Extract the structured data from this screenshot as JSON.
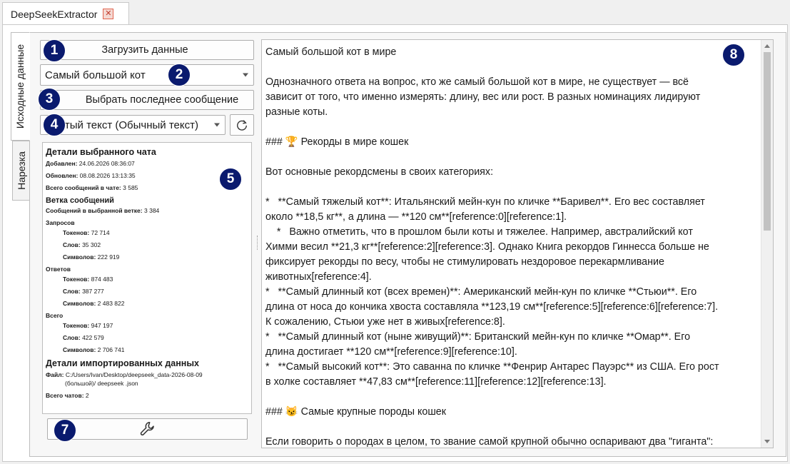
{
  "app": {
    "tab_title": "DeepSeekExtractor",
    "close_glyph": "✕"
  },
  "vertical_tabs": [
    {
      "label": "Исходные данные",
      "active": true
    },
    {
      "label": "Нарезка",
      "active": false
    }
  ],
  "controls": {
    "load_button": "Загрузить данные",
    "chat_select": "Самый большой кот",
    "last_message_button": "Выбрать последнее сообщение",
    "format_select": "Чистый текст (Обычный текст)",
    "refresh_icon": "refresh-icon",
    "tools_icon": "wrench-icon"
  },
  "badges": [
    "1",
    "2",
    "3",
    "4",
    "5",
    "7",
    "8"
  ],
  "details": {
    "chat_title": "Детали выбранного чата",
    "added_label": "Добавлен:",
    "added_value": "24.06.2026 08:36:07",
    "updated_label": "Обновлен:",
    "updated_value": "08.08.2026 13:13:35",
    "total_msgs_label": "Всего сообщений в чате:",
    "total_msgs_value": "3 585",
    "branch_title": "Ветка сообщений",
    "branch_msgs_label": "Сообщений в выбранной ветке:",
    "branch_msgs_value": "3 384",
    "requests_title": "Запросов",
    "req_tokens_label": "Токенов:",
    "req_tokens_value": "72 714",
    "req_words_label": "Слов:",
    "req_words_value": "35 302",
    "req_chars_label": "Символов:",
    "req_chars_value": "222 919",
    "answers_title": "Ответов",
    "ans_tokens_label": "Токенов:",
    "ans_tokens_value": "874 483",
    "ans_words_label": "Слов:",
    "ans_words_value": "387 277",
    "ans_chars_label": "Символов:",
    "ans_chars_value": "2 483 822",
    "total_title": "Всего",
    "tot_tokens_label": "Токенов:",
    "tot_tokens_value": "947 197",
    "tot_words_label": "Слов:",
    "tot_words_value": "422 579",
    "tot_chars_label": "Символов:",
    "tot_chars_value": "2 706 741",
    "import_title": "Детали импортированных данных",
    "file_label": "Файл:",
    "file_value_1": "C:/Users/Ivan/Desktop/deepseek_data-2026-08-09",
    "file_value_2": "(большой)/ deepseek .json",
    "total_chats_label": "Всего чатов:",
    "total_chats_value": "2"
  },
  "content": {
    "lines": [
      "Самый большой кот в мире",
      "",
      "Однозначного ответа на вопрос, кто же самый большой кот в мире, не существует — всё",
      "зависит от того, что именно измерять: длину, вес или рост. В разных номинациях лидируют",
      "разные коты.",
      "",
      "### 🏆 Рекорды в мире кошек",
      "",
      "Вот основные рекордсмены в своих категориях:",
      "",
      "*   **Самый тяжелый кот**: Итальянский мейн-кун по кличке **Баривел**. Его вес составляет",
      "около **18,5 кг**, а длина — **120 см**[reference:0][reference:1].",
      "    *   Важно отметить, что в прошлом были коты и тяжелее. Например, австралийский кот",
      "Химми весил **21,3 кг**[reference:2][reference:3]. Однако Книга рекордов Гиннесса больше не",
      "фиксирует рекорды по весу, чтобы не стимулировать нездоровое перекармливание",
      "животных[reference:4].",
      "*   **Самый длинный кот (всех времен)**: Американский мейн-кун по кличке **Стьюи**. Его",
      "длина от носа до кончика хвоста составляла **123,19 см**[reference:5][reference:6][reference:7].",
      "К сожалению, Стьюи уже нет в живых[reference:8].",
      "*   **Самый длинный кот (ныне живущий)**: Британский мейн-кун по кличке **Омар**. Его",
      "длина достигает **120 см**[reference:9][reference:10].",
      "*   **Самый высокий кот**: Это саванна по кличке **Фенрир Антарес Пауэрс** из США. Его рост",
      "в холке составляет **47,83 см**[reference:11][reference:12][reference:13].",
      "",
      "### 😼 Самые крупные породы кошек",
      "",
      "Если говорить о породах в целом, то звание самой крупной обычно оспаривают два \"гиганта\":"
    ]
  }
}
